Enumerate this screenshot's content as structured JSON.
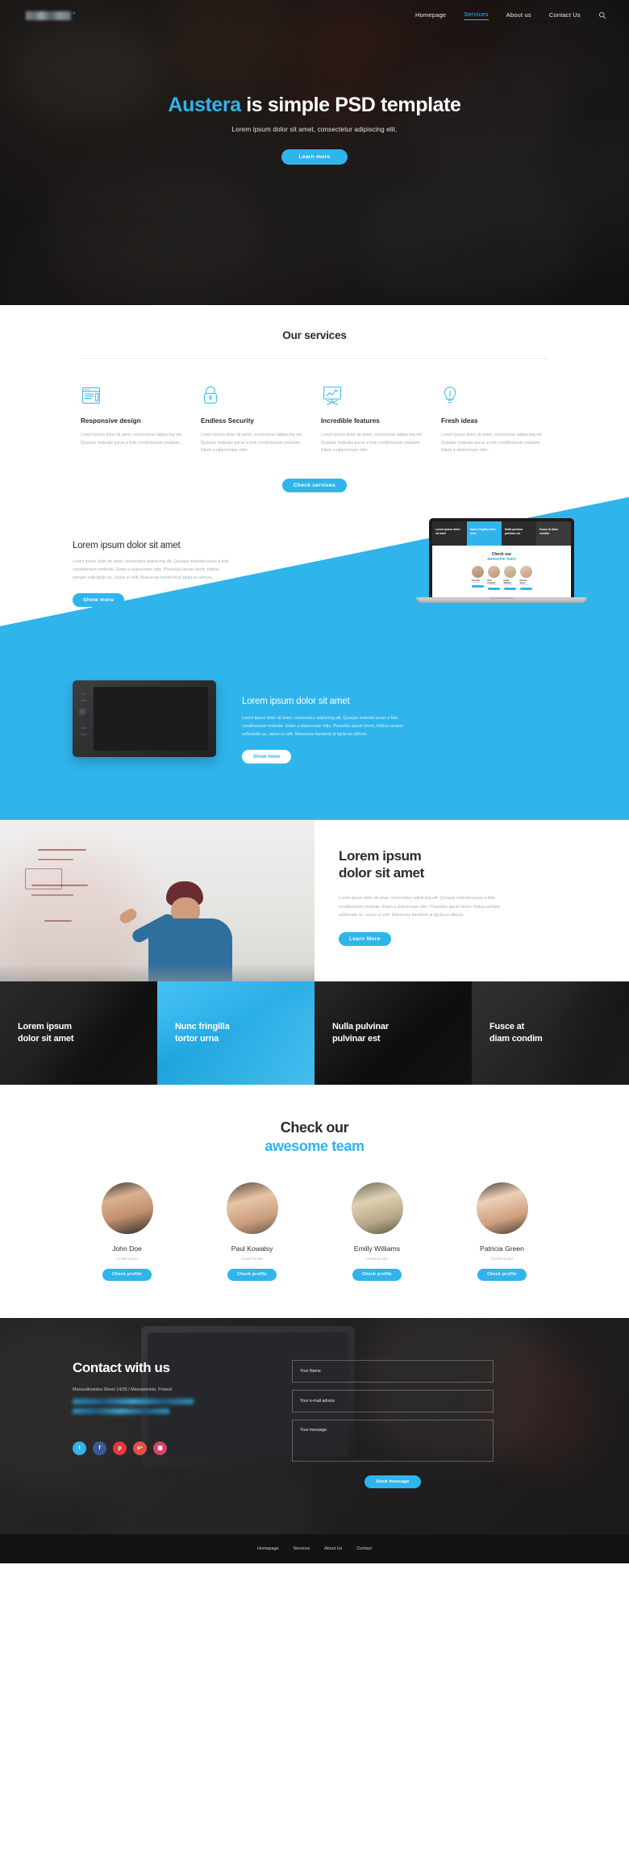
{
  "colors": {
    "accent": "#2fb4ec",
    "dark": "#1a1918",
    "text_dark": "#2c2c2c",
    "text_muted": "#a9aeb3",
    "footer_bg": "#131313"
  },
  "nav": {
    "logo_alt": "austera-logo",
    "links": [
      {
        "label": "Homepage",
        "active": false
      },
      {
        "label": "Services",
        "active": true
      },
      {
        "label": "About us",
        "active": false
      },
      {
        "label": "Contact Us",
        "active": false
      }
    ],
    "search_icon": "search-icon"
  },
  "hero": {
    "title_accent": "Austera",
    "title_rest": " is simple PSD template",
    "subtitle": "Lorem ipsum dolor sit amet, consectetur adipiscing elit.",
    "cta": "Learn more"
  },
  "services": {
    "title": "Our services",
    "cta": "Check services",
    "items": [
      {
        "icon": "browser-window-icon",
        "title": "Responsive design",
        "text": "Lorem ipsum dolor sit amet, consectetur adipiscing elit. Quisque molestie purus a felis condimentum molestie."
      },
      {
        "icon": "padlock-icon",
        "title": "Endless Security",
        "text": "Lorem ipsum dolor sit amet, consectetur adipiscing elit. Quisque molestie purus a felis condimentum molestie. Etiam a ullamcorper odio."
      },
      {
        "icon": "presentation-chart-icon",
        "title": "Incredible features",
        "text": "Lorem ipsum dolor sit amet, consectetur adipiscing elit. Quisque molestie purus a felis condimentum molestie. Etiam a ullamcorper odio."
      },
      {
        "icon": "lightbulb-icon",
        "title": "Fresh ideas",
        "text": "Lorem ipsum dolor sit amet, consectetur adipiscing elit. Quisque molestie purus a felis condimentum molestie. Etiam a ullamcorper odio."
      }
    ]
  },
  "feature_laptop": {
    "heading": "Lorem ipsum dolor sit amet",
    "text": "Lorem ipsum dolor sit amet, consectetur adipiscing elit. Quisque molestie purus a felis condimentum molestie. Etiam a ullamcorper odio. Phasellus ipsum lorem, finibus semper sollicitudin ac, varius ut velit. Maecenas hendrerit at ligula eu ultrices.",
    "cta": "Show more",
    "screen": {
      "strip": [
        "Lorem ipsum dolor sit amet",
        "Nunc fringilla tortor urna",
        "Nulla pulvinar pulvinar est",
        "Fusce at diam condim"
      ],
      "mid_line1": "Check our",
      "mid_line2": "awesome team",
      "members": [
        {
          "name": "John Doe",
          "role": "Ceo&Founder",
          "button": "Check profile"
        },
        {
          "name": "Paul Kowalsy",
          "role": "Ceo&Founder",
          "button": "Check profile"
        },
        {
          "name": "Emilly Williams",
          "role": "Ceo&Founder",
          "button": "Check profile"
        },
        {
          "name": "Patricia Green",
          "role": "Ceo&Founder",
          "button": "Check profile"
        }
      ]
    }
  },
  "feature_tablet": {
    "heading": "Lorem ipsum dolor sit amet",
    "text": "Lorem ipsum dolor sit amet, consectetur adipiscing elit. Quisque molestie purus a felis condimentum molestie. Etiam a ullamcorper odio. Phasellus ipsum lorem, finibus semper sollicitudin ac, varius ut velit. Maecenas hendrerit at ligula eu ultrices.",
    "cta": "Show more"
  },
  "split": {
    "image_alt": "whiteboard-brainstorm-photo",
    "heading_line1": "Lorem ipsum",
    "heading_line2": "dolor sit amet",
    "text": "Lorem ipsum dolor sit amet, consectetur adipiscing elit. Quisque molestie purus a felis condimentum molestie. Etiam a ullamcorper odio. Phasellus ipsum lorem, finibus semper sollicitudin ac, varius ut velit. Maecenas hendrerit at ligula eu ultrices.",
    "cta": "Learn More"
  },
  "tiles": [
    {
      "line1": "Lorem ipsum",
      "line2": "dolor sit amet",
      "highlight": false
    },
    {
      "line1": "Nunc fringilla",
      "line2": "tortor urna",
      "highlight": true
    },
    {
      "line1": "Nulla pulvinar",
      "line2": "pulvinar est",
      "highlight": false
    },
    {
      "line1": "Fusce at",
      "line2": "diam condim",
      "highlight": false
    }
  ],
  "team": {
    "heading_line1": "Check our",
    "heading_line2": "awesome team",
    "members": [
      {
        "name": "John Doe",
        "role": "Ceo&Founder",
        "button": "Check profile"
      },
      {
        "name": "Paul Kowalsy",
        "role": "Ceo&Founder",
        "button": "Check profile"
      },
      {
        "name": "Emilly Williams",
        "role": "Ceo&Founder",
        "button": "Check profile"
      },
      {
        "name": "Patricia Green",
        "role": "Ceo&Founder",
        "button": "Check profile"
      }
    ]
  },
  "contact": {
    "heading": "Contact with us",
    "address": "Marszalkowska Street 14/35 / Mazowieckie, Poland",
    "socials": [
      {
        "name": "twitter-icon",
        "glyph": "t",
        "color": "#2fb4ec"
      },
      {
        "name": "facebook-icon",
        "glyph": "f",
        "color": "#3b5998"
      },
      {
        "name": "pinterest-icon",
        "glyph": "p",
        "color": "#e03a3e"
      },
      {
        "name": "google-plus-icon",
        "glyph": "g+",
        "color": "#dd5044"
      },
      {
        "name": "instagram-icon",
        "glyph": "▣",
        "color": "#d4436a"
      }
    ],
    "fields": {
      "name_placeholder": "Your Name",
      "email_placeholder": "Your e-mail adress",
      "message_placeholder": "Your message"
    },
    "cta": "Send message"
  },
  "footer": {
    "links": [
      "Homepage",
      "Services",
      "About Us",
      "Contact"
    ]
  }
}
